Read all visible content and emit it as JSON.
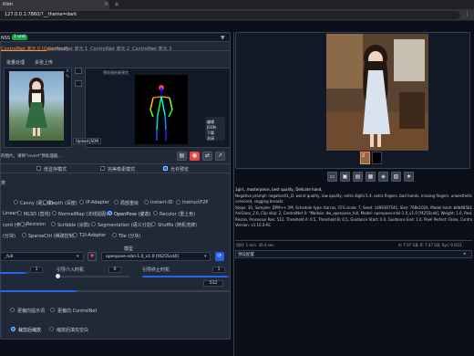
{
  "browser": {
    "tab_title": "ition",
    "url": "127.0.0.1:7860/?__theme=dark"
  },
  "controlnet": {
    "header_title": "NSS",
    "badge": "1 unit",
    "tabs": [
      "ControlNet 单元 0 [OpenPose]",
      "ControlNet 单元 1",
      "ControlNet 单元 2",
      "ControlNet 单元 3"
    ],
    "subtabs": [
      "批量处理",
      "多张上传"
    ],
    "upload_label": "Upload JSON",
    "preprocessor_preview_label": "预处理结果预览",
    "side_labels": [
      "编辑",
      "JSON",
      "下载",
      "关闭"
    ],
    "hint_text": "的图片。请将\"invert\"预处理器...",
    "options": [
      {
        "label": "低显存模式",
        "checked": false
      },
      {
        "label": "完美像素模式",
        "checked": false
      },
      {
        "label": "允许预览",
        "checked": true
      }
    ],
    "types_label": "类",
    "types": [
      [
        "Canny (硬边缘)",
        "Depth (深度)",
        "IP-Adapter",
        "局部重绘",
        "Instant-ID",
        "InstructP2P"
      ],
      [
        "Lineart",
        "MLSD (直线)",
        "NormalMap (法线贴图)",
        "OpenPose (姿态)",
        "Recolor (重上色)"
      ],
      [
        "cord (参考)",
        "Revision",
        "Scribble (涂鸦)",
        "Segmentation (语义分割)",
        "Shuffle (随机洗牌)"
      ],
      [
        "(分块)",
        "SparseCtrl (稀疏控制)",
        "T2I-Adapter",
        "Tile (分块)"
      ]
    ],
    "selected_type": "OpenPose (姿态)",
    "model_label": "模型",
    "preprocessor_value": "_full",
    "model_value": "openpose-sdxl-1.0_v1.0 [f4255cd4]",
    "weight_value": "1",
    "start_label": "引导介入时机",
    "start_value": "0",
    "end_label": "引导终止时机",
    "end_value": "1",
    "res_value": "512",
    "control_mode_labels": [
      "更偏向提示词",
      "更偏向 ControlNet"
    ],
    "resize_labels": [
      "裁剪后缩放",
      "缩放后填充空白"
    ],
    "resize_selected": "裁剪后缩放"
  },
  "output": {
    "gallery_icons": [
      "folder-icon",
      "save-icon",
      "zip-icon",
      "send-img2img-icon",
      "send-inpaint-icon",
      "send-extras-icon",
      "star-icon"
    ],
    "info_lines": [
      "1girl,, masterpiece, best quality, Delicate hand,",
      "Negative prompt: negativeXL_D, worst quality, low quality, extra digits:1.4, extra fingers, bad hands, missing fingers, unaestheticXL2v10",
      "censored, sagging breasts",
      "Steps: 30, Sampler: DPM++ 2M, Schedule type: Karras, CFG scale: 7, Seed: 1466367541, Size: 768x1024, Model hash: b0b685b194, Model",
      "AniGloss_2.0, Clip skip: 2, ControlNet 0: \"Module: dw_openpose_full, Model: openpose-sdxl-1.0_v1.0 [f4255cd4], Weight: 1.0, Resize Mo",
      "Resize, Processor Res: 512, Threshold A: 0.5, Threshold B: 0.5, Guidance Start: 0.0, Guidance End: 1.0, Pixel Perfect: False, Control Mode",
      "Version: v1.10.0-RC"
    ],
    "time_text": "用时: 1 min. 36.4 sec.",
    "vram_text": "A: 7.97 GB, R: 7.47 GB, Sys: 9.0/11",
    "preset_label": "预设配置",
    "thumb_count": "2"
  }
}
